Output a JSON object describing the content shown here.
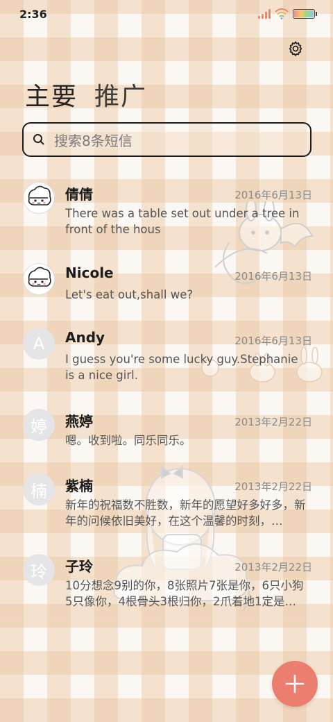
{
  "status_bar": {
    "time": "2:36"
  },
  "tabs": [
    {
      "label": "主要"
    },
    {
      "label": "推广"
    }
  ],
  "search": {
    "placeholder": "搜索8条短信"
  },
  "messages": [
    {
      "name": "倩倩",
      "date": "2016年6月13日",
      "preview": "There was a table set out under a tree in front of the hous",
      "avatar_type": "pic",
      "avatar_text": ""
    },
    {
      "name": "Nicole",
      "date": "2016年6月13日",
      "preview": "Let's eat out,shall we?",
      "avatar_type": "pic",
      "avatar_text": ""
    },
    {
      "name": "Andy",
      "date": "2016年6月13日",
      "preview": "I guess you're some lucky guy.Stephanie is a nice girl.",
      "avatar_type": "letter",
      "avatar_text": "A"
    },
    {
      "name": "燕婷",
      "date": "2013年2月22日",
      "preview": "嗯。收到啦。同乐同乐。",
      "avatar_type": "letter",
      "avatar_text": "婷"
    },
    {
      "name": "紫楠",
      "date": "2013年2月22日",
      "preview": "新年的祝福数不胜数，新年的愿望好多好多，新年的问候依旧美好，在这个温馨的时刻，…",
      "avatar_type": "letter",
      "avatar_text": "楠"
    },
    {
      "name": "子玲",
      "date": "2013年2月22日",
      "preview": "10分想念9别的你，8张照片7张是你，6只小狗5只像你，4根骨头3根归你，2爪着地1定是…",
      "avatar_type": "letter",
      "avatar_text": "玲"
    }
  ],
  "icons": {
    "settings": "gear-icon",
    "search": "search-icon",
    "compose": "plus-icon"
  },
  "colors": {
    "fab": "#ec7e6f",
    "avatar_letter_bg": "#e5e5e8",
    "check_pattern": "#e9c49e"
  }
}
